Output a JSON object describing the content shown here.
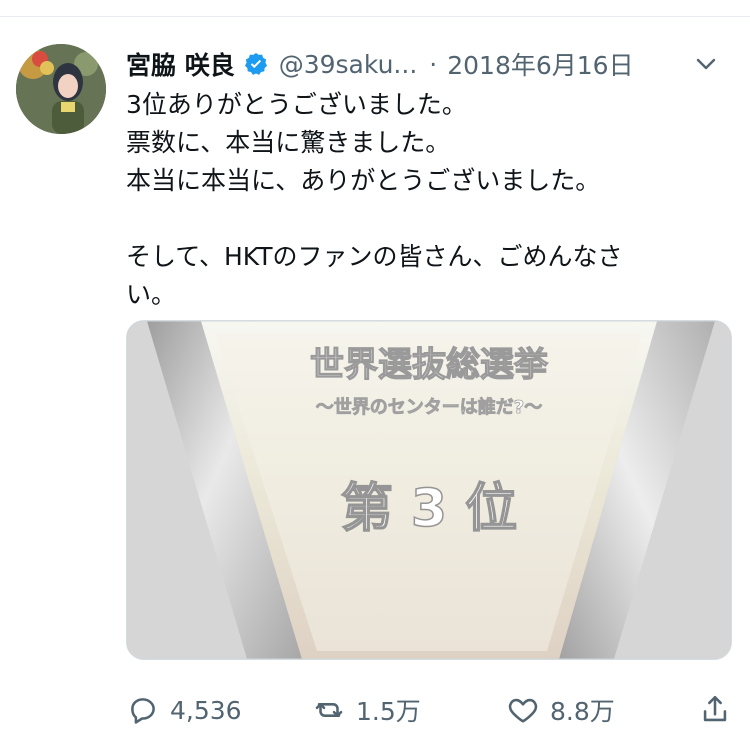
{
  "tweet": {
    "display_name": "宮脇 咲良",
    "handle": "@39saku...",
    "separator": "·",
    "date": "2018年6月16日",
    "verified": true,
    "text_lines": [
      "3位ありがとうございました。",
      "票数に、本当に驚きました。",
      "本当に本当に、ありがとうございました。",
      "",
      "そして、HKTのファンの皆さん、ごめんなさ",
      "い。"
    ],
    "media": {
      "line1": "世界選抜総選挙",
      "line2": "〜世界のセンターは誰だ?〜",
      "rank": "第 3 位"
    },
    "actions": {
      "reply_count": "4,536",
      "retweet_count": "1.5万",
      "like_count": "8.8万"
    }
  },
  "colors": {
    "verified_blue": "#1d9bf0",
    "secondary_text": "#536471",
    "primary_text": "#0f1419"
  },
  "icons": {
    "verified": "verified-badge-icon",
    "menu": "chevron-down-icon",
    "reply": "reply-bubble-icon",
    "retweet": "retweet-arrows-icon",
    "like": "heart-icon",
    "share": "share-upload-icon"
  }
}
